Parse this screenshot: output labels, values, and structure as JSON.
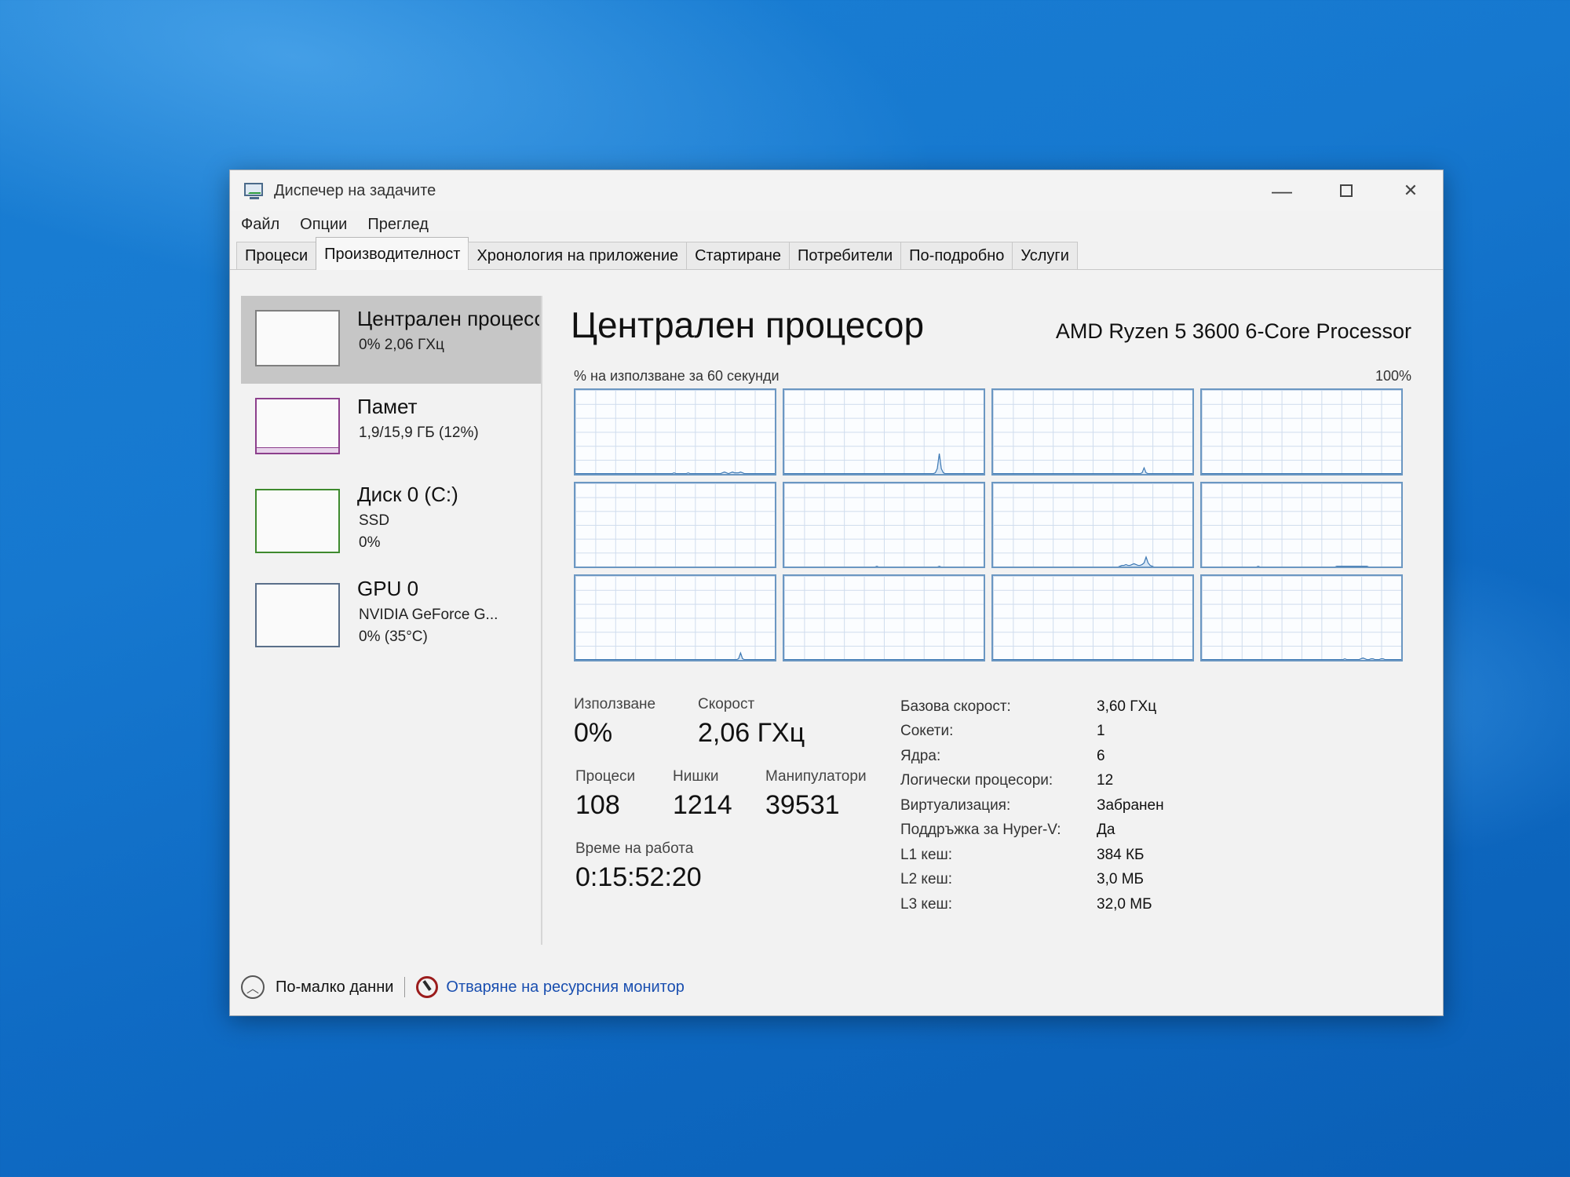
{
  "window": {
    "title": "Диспечер на задачите",
    "controls": {
      "minimize": "—",
      "close": "✕"
    }
  },
  "menu": [
    "Файл",
    "Опции",
    "Преглед"
  ],
  "tabs": [
    "Процеси",
    "Производителност",
    "Хронология на приложение",
    "Стартиране",
    "Потребители",
    "По-подробно",
    "Услуги"
  ],
  "active_tab": "Производителност",
  "sidebar": [
    {
      "name": "Централен процесор",
      "lines": [
        "0% 2,06 ГХц"
      ]
    },
    {
      "name": "Памет",
      "lines": [
        "1,9/15,9 ГБ (12%)"
      ]
    },
    {
      "name": "Диск 0 (C:)",
      "lines": [
        "SSD",
        "0%"
      ]
    },
    {
      "name": "GPU 0",
      "lines": [
        "NVIDIA GeForce G...",
        "0% (35°C)"
      ]
    }
  ],
  "main": {
    "title": "Централен процесор",
    "model": "AMD Ryzen 5 3600 6-Core Processor",
    "graph_label": "% на използване за 60 секунди",
    "graph_max": "100%"
  },
  "stats": {
    "usage_label": "Използване",
    "usage": "0%",
    "speed_label": "Скорост",
    "speed": "2,06 ГХц",
    "processes_label": "Процеси",
    "processes": "108",
    "threads_label": "Нишки",
    "threads": "1214",
    "handles_label": "Манипулатори",
    "handles": "39531",
    "uptime_label": "Време на работа",
    "uptime": "0:15:52:20"
  },
  "specs": [
    {
      "k": "Базова скорост:",
      "v": "3,60 ГХц"
    },
    {
      "k": "Сокети:",
      "v": "1"
    },
    {
      "k": "Ядра:",
      "v": "6"
    },
    {
      "k": "Логически процесори:",
      "v": "12"
    },
    {
      "k": "Виртуализация:",
      "v": "Забранен"
    },
    {
      "k": "Поддръжка за Hyper-V:",
      "v": "Да"
    },
    {
      "k": "L1 кеш:",
      "v": "384 КБ"
    },
    {
      "k": "L2 кеш:",
      "v": "3,0 МБ"
    },
    {
      "k": "L3 кеш:",
      "v": "32,0 МБ"
    }
  ],
  "footer": {
    "fewer_details": "По-малко данни",
    "open_resmon": "Отваряне на ресурсния монитор"
  },
  "core_graphs": {
    "colors": {
      "line": "#3c78b4",
      "fill": "#d9e7f5"
    },
    "cores": [
      [
        0,
        0,
        0,
        0,
        0,
        0,
        0,
        0,
        0,
        0,
        0,
        0,
        0,
        0,
        0,
        0,
        0,
        0,
        0,
        0,
        0,
        0,
        0,
        0,
        0,
        0,
        0,
        0,
        0,
        0,
        0,
        0,
        0,
        0,
        0,
        0,
        0,
        0,
        0,
        0,
        0,
        0,
        0,
        0,
        0,
        0,
        0,
        0,
        0,
        1,
        0,
        0,
        0,
        0,
        0,
        0,
        1,
        0,
        0,
        0,
        0,
        0,
        0,
        0,
        0,
        0,
        0,
        0,
        0,
        0,
        0,
        0,
        0,
        1,
        2,
        1,
        0,
        1,
        2,
        1,
        1,
        1,
        2,
        1,
        0,
        0,
        0,
        0,
        0,
        0,
        0,
        0,
        0,
        0,
        0,
        0,
        0,
        0,
        0,
        0
      ],
      [
        0,
        0,
        0,
        0,
        0,
        0,
        0,
        0,
        0,
        0,
        0,
        0,
        0,
        0,
        0,
        0,
        0,
        0,
        0,
        0,
        0,
        0,
        0,
        0,
        0,
        0,
        0,
        0,
        0,
        0,
        0,
        0,
        0,
        0,
        0,
        0,
        0,
        0,
        0,
        0,
        0,
        0,
        0,
        0,
        0,
        0,
        0,
        0,
        0,
        0,
        0,
        0,
        0,
        0,
        0,
        0,
        0,
        0,
        0,
        0,
        0,
        0,
        0,
        0,
        0,
        0,
        0,
        0,
        0,
        0,
        0,
        0,
        0,
        0,
        0,
        1,
        6,
        24,
        6,
        1,
        0,
        0,
        0,
        0,
        0,
        0,
        0,
        0,
        0,
        0,
        0,
        0,
        0,
        0,
        0,
        0,
        0,
        0,
        0,
        0
      ],
      [
        0,
        0,
        0,
        0,
        0,
        0,
        0,
        0,
        0,
        0,
        0,
        0,
        0,
        0,
        0,
        0,
        0,
        0,
        0,
        0,
        0,
        0,
        0,
        0,
        0,
        0,
        0,
        0,
        0,
        0,
        0,
        0,
        0,
        0,
        0,
        0,
        0,
        0,
        0,
        0,
        0,
        0,
        0,
        0,
        0,
        0,
        0,
        0,
        0,
        0,
        0,
        0,
        0,
        0,
        0,
        0,
        0,
        0,
        0,
        0,
        0,
        0,
        0,
        0,
        0,
        0,
        0,
        0,
        0,
        0,
        0,
        0,
        0,
        0,
        1,
        7,
        1,
        0,
        0,
        0,
        0,
        0,
        0,
        0,
        0,
        0,
        0,
        0,
        0,
        0,
        0,
        0,
        0,
        0,
        0,
        0,
        0,
        0,
        0,
        0
      ],
      [
        0,
        0,
        0,
        0,
        0,
        0,
        0,
        0,
        0,
        0,
        0,
        0,
        0,
        0,
        0,
        0,
        0,
        0,
        0,
        0,
        0,
        0,
        0,
        0,
        0,
        0,
        0,
        0,
        0,
        0,
        0,
        0,
        0,
        0,
        0,
        0,
        0,
        0,
        0,
        0,
        0,
        0,
        0,
        0,
        0,
        0,
        0,
        0,
        0,
        0,
        0,
        0,
        0,
        0,
        0,
        0,
        0,
        0,
        0,
        0,
        0,
        0,
        0,
        0,
        0,
        0,
        0,
        0,
        0,
        0,
        0,
        0,
        0,
        0,
        0,
        0,
        0,
        0,
        0,
        0,
        0,
        0,
        0,
        0,
        0,
        0,
        0,
        0,
        0,
        0,
        0,
        0,
        0,
        0,
        0,
        0,
        0,
        0,
        0,
        0
      ],
      [
        0,
        0,
        0,
        0,
        0,
        0,
        0,
        0,
        0,
        0,
        0,
        0,
        0,
        0,
        0,
        0,
        0,
        0,
        0,
        0,
        0,
        0,
        0,
        0,
        0,
        0,
        0,
        0,
        0,
        0,
        0,
        0,
        0,
        0,
        0,
        0,
        0,
        0,
        0,
        0,
        0,
        0,
        0,
        0,
        0,
        0,
        0,
        0,
        0,
        0,
        0,
        0,
        0,
        0,
        0,
        0,
        0,
        0,
        0,
        0,
        0,
        0,
        0,
        0,
        0,
        0,
        0,
        0,
        0,
        0,
        0,
        0,
        0,
        0,
        0,
        0,
        0,
        0,
        0,
        0,
        0,
        0,
        0,
        0,
        0,
        0,
        0,
        0,
        0,
        0,
        0,
        0,
        0,
        0,
        0,
        0,
        0,
        0,
        0,
        0
      ],
      [
        0,
        0,
        0,
        0,
        0,
        0,
        0,
        0,
        0,
        0,
        0,
        0,
        0,
        0,
        0,
        0,
        0,
        0,
        0,
        0,
        0,
        0,
        0,
        0,
        0,
        0,
        0,
        0,
        0,
        0,
        0,
        0,
        0,
        0,
        0,
        0,
        0,
        0,
        0,
        0,
        0,
        0,
        0,
        0,
        0,
        0,
        1,
        0,
        0,
        0,
        0,
        0,
        0,
        0,
        0,
        0,
        0,
        0,
        0,
        0,
        0,
        0,
        0,
        0,
        0,
        0,
        0,
        0,
        0,
        0,
        0,
        0,
        0,
        0,
        0,
        0,
        0,
        1,
        0,
        0,
        0,
        0,
        0,
        0,
        0,
        0,
        0,
        0,
        0,
        0,
        0,
        0,
        0,
        0,
        0,
        0,
        0,
        0,
        0,
        0
      ],
      [
        0,
        0,
        0,
        0,
        0,
        0,
        0,
        0,
        0,
        0,
        0,
        0,
        0,
        0,
        0,
        0,
        0,
        0,
        0,
        0,
        0,
        0,
        0,
        0,
        0,
        0,
        0,
        0,
        0,
        0,
        0,
        0,
        0,
        0,
        0,
        0,
        0,
        0,
        0,
        0,
        0,
        0,
        0,
        0,
        0,
        0,
        0,
        0,
        0,
        0,
        0,
        0,
        0,
        0,
        0,
        0,
        0,
        0,
        0,
        0,
        0,
        0,
        0,
        1,
        2,
        2,
        3,
        2,
        2,
        3,
        4,
        3,
        2,
        2,
        3,
        5,
        12,
        5,
        2,
        1,
        0,
        0,
        0,
        0,
        0,
        0,
        0,
        0,
        0,
        0,
        0,
        0,
        0,
        0,
        0,
        0,
        0,
        0,
        0,
        0
      ],
      [
        0,
        0,
        0,
        0,
        0,
        0,
        0,
        0,
        0,
        0,
        0,
        0,
        0,
        0,
        0,
        0,
        0,
        0,
        0,
        0,
        0,
        0,
        0,
        0,
        0,
        0,
        0,
        0,
        1,
        0,
        0,
        0,
        0,
        0,
        0,
        0,
        0,
        0,
        0,
        0,
        0,
        0,
        0,
        0,
        0,
        0,
        0,
        0,
        0,
        0,
        0,
        0,
        0,
        0,
        0,
        0,
        0,
        0,
        0,
        0,
        0,
        0,
        0,
        0,
        0,
        0,
        0,
        1,
        1,
        1,
        1,
        1,
        1,
        1,
        1,
        1,
        1,
        1,
        1,
        1,
        1,
        1,
        1,
        0,
        0,
        0,
        0,
        0,
        0,
        0,
        0,
        0,
        0,
        0,
        0,
        0,
        0,
        0,
        0,
        0
      ],
      [
        0,
        0,
        0,
        0,
        0,
        0,
        0,
        0,
        0,
        0,
        0,
        0,
        0,
        0,
        0,
        0,
        0,
        0,
        0,
        0,
        0,
        0,
        0,
        0,
        0,
        0,
        0,
        0,
        0,
        0,
        0,
        0,
        0,
        0,
        0,
        0,
        0,
        0,
        0,
        0,
        0,
        0,
        0,
        0,
        0,
        0,
        0,
        0,
        0,
        0,
        0,
        0,
        0,
        0,
        0,
        0,
        0,
        0,
        0,
        0,
        0,
        0,
        0,
        0,
        0,
        0,
        0,
        0,
        0,
        0,
        0,
        0,
        0,
        0,
        0,
        0,
        0,
        0,
        0,
        0,
        0,
        1,
        8,
        1,
        0,
        0,
        0,
        0,
        0,
        0,
        0,
        0,
        0,
        0,
        0,
        0,
        0,
        0,
        0,
        0
      ],
      [
        0,
        0,
        0,
        0,
        0,
        0,
        0,
        0,
        0,
        0,
        0,
        0,
        0,
        0,
        0,
        0,
        0,
        0,
        0,
        0,
        0,
        0,
        0,
        0,
        0,
        0,
        0,
        0,
        0,
        0,
        0,
        0,
        0,
        0,
        0,
        0,
        0,
        0,
        0,
        0,
        0,
        0,
        0,
        0,
        0,
        0,
        0,
        0,
        0,
        0,
        0,
        0,
        0,
        0,
        0,
        0,
        0,
        0,
        0,
        0,
        0,
        0,
        0,
        0,
        0,
        0,
        0,
        0,
        0,
        0,
        0,
        0,
        0,
        0,
        0,
        0,
        0,
        0,
        0,
        0,
        0,
        0,
        0,
        0,
        0,
        0,
        0,
        0,
        0,
        0,
        0,
        0,
        0,
        0,
        0,
        0,
        0,
        0,
        0,
        0
      ],
      [
        0,
        0,
        0,
        0,
        0,
        0,
        0,
        0,
        0,
        0,
        0,
        0,
        0,
        0,
        0,
        0,
        0,
        0,
        0,
        0,
        0,
        0,
        0,
        0,
        0,
        0,
        0,
        0,
        0,
        0,
        0,
        0,
        0,
        0,
        0,
        0,
        0,
        0,
        0,
        0,
        0,
        0,
        0,
        0,
        0,
        0,
        0,
        0,
        0,
        0,
        0,
        0,
        0,
        0,
        0,
        0,
        0,
        0,
        0,
        0,
        0,
        0,
        0,
        0,
        0,
        0,
        0,
        0,
        0,
        0,
        0,
        0,
        0,
        0,
        0,
        0,
        0,
        0,
        0,
        0,
        0,
        0,
        0,
        0,
        0,
        0,
        0,
        0,
        0,
        0,
        0,
        0,
        0,
        0,
        0,
        0,
        0,
        0,
        0,
        0
      ],
      [
        0,
        0,
        0,
        0,
        0,
        0,
        0,
        0,
        0,
        0,
        0,
        0,
        0,
        0,
        0,
        0,
        0,
        0,
        0,
        0,
        0,
        0,
        0,
        0,
        0,
        0,
        0,
        0,
        0,
        0,
        0,
        0,
        0,
        0,
        0,
        0,
        0,
        0,
        0,
        0,
        0,
        0,
        0,
        0,
        0,
        0,
        0,
        0,
        0,
        0,
        0,
        0,
        0,
        0,
        0,
        0,
        0,
        0,
        0,
        0,
        0,
        0,
        0,
        0,
        0,
        0,
        0,
        0,
        0,
        0,
        0,
        1,
        0,
        0,
        0,
        0,
        0,
        0,
        0,
        1,
        2,
        1,
        0,
        0,
        1,
        1,
        0,
        0,
        0,
        1,
        1,
        0,
        0,
        0,
        0,
        0,
        0,
        0,
        0,
        0
      ]
    ]
  }
}
